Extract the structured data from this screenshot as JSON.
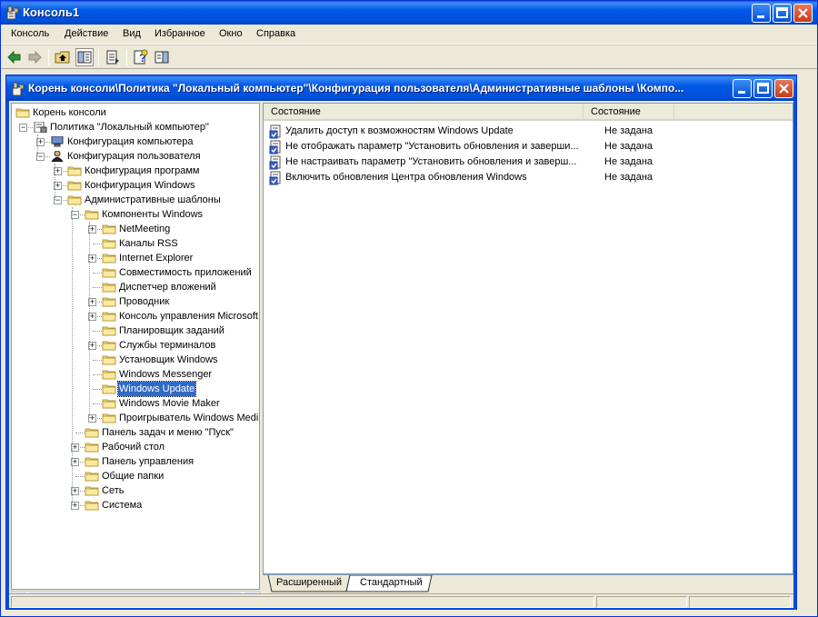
{
  "app": {
    "title": "Консоль1"
  },
  "menubar": [
    "Консоль",
    "Действие",
    "Вид",
    "Избранное",
    "Окно",
    "Справка"
  ],
  "inner_window": {
    "title": "Корень консоли\\Политика \"Локальный компьютер\"\\Конфигурация пользователя\\Административные шаблоны \\Компо..."
  },
  "tree": {
    "root": "Корень консоли",
    "policy": "Политика \"Локальный компьютер\"",
    "computer_config": "Конфигурация компьютера",
    "user_config": "Конфигурация пользователя",
    "software_config": "Конфигурация программ",
    "windows_config": "Конфигурация Windows",
    "admin_templates": "Административные шаблоны",
    "windows_components": "Компоненты Windows",
    "components": [
      "NetMeeting",
      "Каналы RSS",
      "Internet Explorer",
      "Совместимость приложений",
      "Диспетчер вложений",
      "Проводник",
      "Консоль управления Microsoft",
      "Планировщик заданий",
      "Службы терминалов",
      "Установщик Windows",
      "Windows Messenger",
      "Windows Update",
      "Windows Movie Maker",
      "Проигрыватель Windows Media"
    ],
    "admin_children": [
      "Панель задач и меню \"Пуск\"",
      "Рабочий стол",
      "Панель управления",
      "Общие папки",
      "Сеть",
      "Система"
    ],
    "selected": "Windows Update"
  },
  "list": {
    "columns": [
      "Состояние",
      "Состояние"
    ],
    "rows": [
      {
        "name": "Удалить доступ к возможностям Windows Update",
        "state": "Не задана"
      },
      {
        "name": "Не отображать параметр \"Установить обновления и заверши...",
        "state": "Не задана"
      },
      {
        "name": "Не настраивать параметр \"Установить обновления и заверш...",
        "state": "Не задана"
      },
      {
        "name": "Включить обновления Центра обновления Windows",
        "state": "Не задана"
      }
    ]
  },
  "tabs": [
    "Расширенный",
    "Стандартный"
  ],
  "colors": {
    "titlebar": "#0058e6",
    "selection": "#316ac5",
    "chrome": "#ece9d8"
  },
  "icons": [
    "app-icon",
    "back-icon",
    "forward-icon",
    "up-icon",
    "show-hide-tree-icon",
    "export-list-icon",
    "help-icon",
    "action-pane-icon",
    "folder-icon",
    "policy-setting-icon"
  ]
}
